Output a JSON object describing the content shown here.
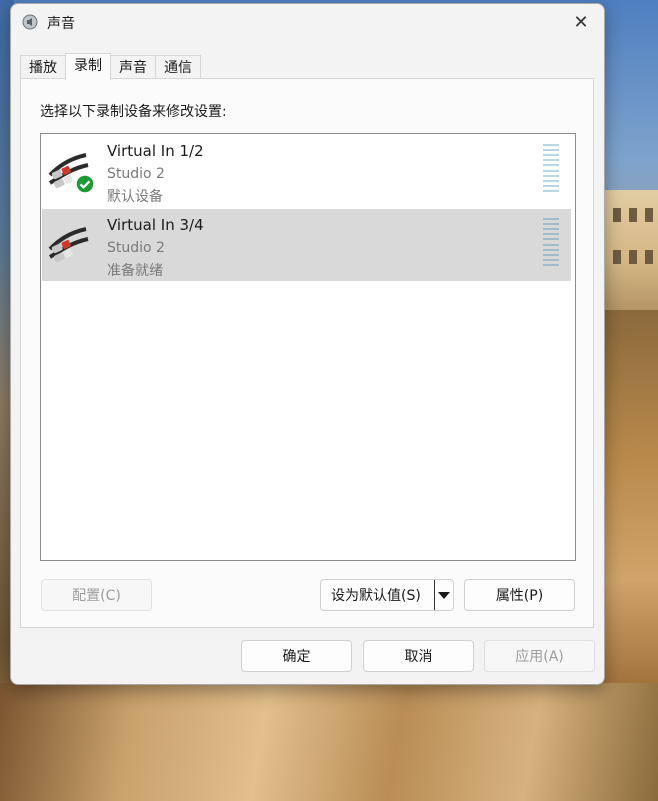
{
  "window": {
    "title": "声音",
    "close_glyph": "✕"
  },
  "tabs": [
    {
      "label": "播放",
      "active": false
    },
    {
      "label": "录制",
      "active": true
    },
    {
      "label": "声音",
      "active": false
    },
    {
      "label": "通信",
      "active": false
    }
  ],
  "panel": {
    "instruction": "选择以下录制设备来修改设置:"
  },
  "devices": [
    {
      "name": "Virtual In 1/2",
      "subtitle": "Studio 2",
      "status": "默认设备",
      "is_default": true,
      "selected": false,
      "icon": "rca-cable-icon"
    },
    {
      "name": "Virtual In 3/4",
      "subtitle": "Studio 2",
      "status": "准备就绪",
      "is_default": false,
      "selected": true,
      "icon": "rca-cable-icon"
    }
  ],
  "buttons": {
    "configure": "配置(C)",
    "set_default": "设为默认值(S)",
    "properties": "属性(P)",
    "ok": "确定",
    "cancel": "取消",
    "apply": "应用(A)"
  },
  "colors": {
    "default_badge": "#1e9a35",
    "selected_row": "#d9d9d9",
    "meter": "#b9d6e6"
  }
}
